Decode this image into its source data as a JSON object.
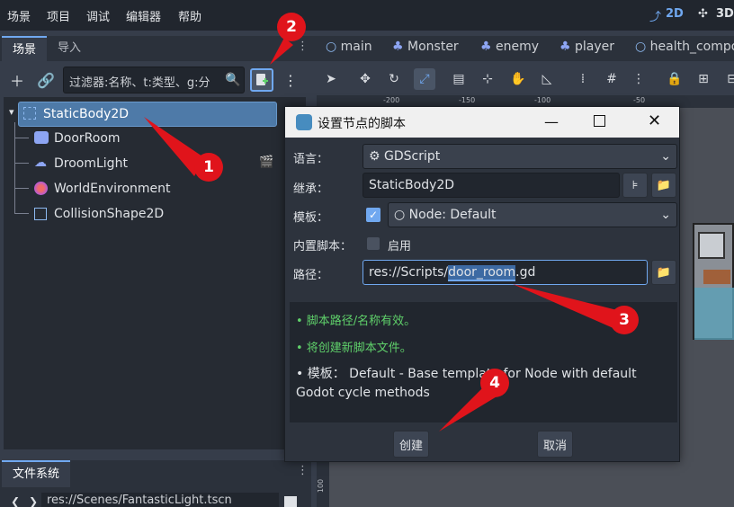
{
  "menu": [
    "场景",
    "项目",
    "调试",
    "编辑器",
    "帮助"
  ],
  "modes": {
    "2d": "2D",
    "3d": "3D"
  },
  "scene_dock": {
    "tabs": [
      "场景",
      "导入"
    ],
    "filter_placeholder": "过滤器:名称、t:类型、g:分",
    "tree": [
      {
        "label": "StaticBody2D",
        "icon": "static-body-icon",
        "selected": true
      },
      {
        "label": "DoorRoom",
        "icon": "sprite-icon"
      },
      {
        "label": "DroomLight",
        "icon": "light-icon"
      },
      {
        "label": "WorldEnvironment",
        "icon": "globe-icon"
      },
      {
        "label": "CollisionShape2D",
        "icon": "collision-shape-icon"
      }
    ]
  },
  "filesystem": {
    "tab": "文件系统",
    "path": "res://Scenes/FantasticLight.tscn"
  },
  "editor_tabs": [
    "main",
    "Monster",
    "enemy",
    "player",
    "health_compo"
  ],
  "ruler_labels": [
    "-200",
    "-150",
    "-100",
    "-50",
    "100"
  ],
  "dialog": {
    "title": "设置节点的脚本",
    "language_label": "语言：",
    "language_value": "GDScript",
    "inherits_label": "继承：",
    "inherits_value": "StaticBody2D",
    "template_label": "模板：",
    "template_value": "Node: Default",
    "builtin_label": "内置脚本：",
    "builtin_option": "启用",
    "path_label": "路径：",
    "path_prefix": "res://Scripts/",
    "path_name": "door_room",
    "path_ext": ".gd",
    "messages": [
      "• 脚本路径/名称有效。",
      "• 将创建新脚本文件。"
    ],
    "template_desc": "• 模板： Default - Base template for Node with default Godot cycle methods",
    "create_button": "创建",
    "cancel_button": "取消"
  },
  "annotations": [
    "1",
    "2",
    "3",
    "4"
  ],
  "colors": {
    "accent": "#70a8f0",
    "success": "#5fd06a",
    "annotation": "#e0141b"
  }
}
